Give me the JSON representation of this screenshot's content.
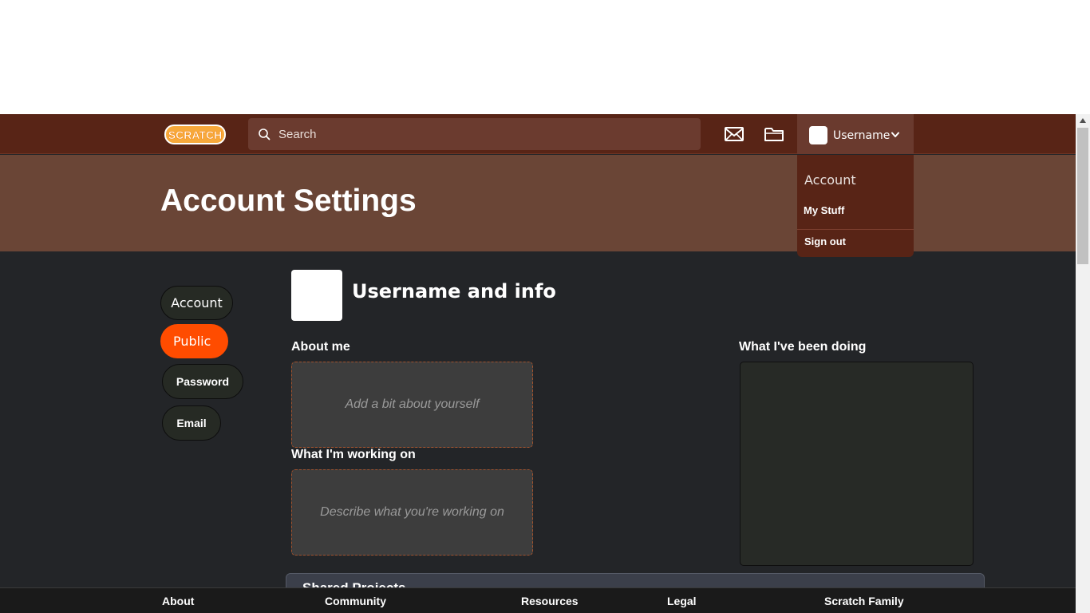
{
  "navbar": {
    "logo_text": "SCRATCH",
    "search_placeholder": "Search",
    "username": "Username"
  },
  "dropdown": {
    "items": [
      "Account",
      "My Stuff",
      "Sign out"
    ]
  },
  "header": {
    "title": "Account Settings"
  },
  "sidebar": {
    "items": [
      {
        "label": "Account",
        "active": false
      },
      {
        "label": "Public",
        "active": true
      },
      {
        "label": "Password",
        "active": false
      },
      {
        "label": "Email",
        "active": false
      }
    ]
  },
  "main": {
    "section_heading": "Username and info",
    "about_label": "About me",
    "about_placeholder": "Add a bit about yourself",
    "working_label": "What I'm working on",
    "working_placeholder": "Describe what you're working on",
    "doing_label": "What I've been doing",
    "shared_projects_title": "Shared Projects"
  },
  "footer": {
    "links": [
      "About",
      "Community",
      "Resources",
      "Legal",
      "Scratch Family"
    ]
  },
  "colors": {
    "navbar": "#582416",
    "header_band": "#6a4536",
    "accent": "#ff4c00",
    "background": "#232528"
  }
}
